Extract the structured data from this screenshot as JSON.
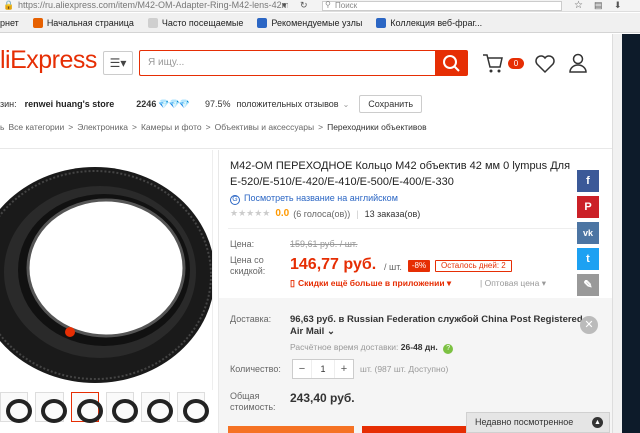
{
  "browser": {
    "url": "https://ru.aliexpress.com/item/M42-OM-Adapter-Ring-M42-lens-42mm",
    "search_placeholder": "Поиск",
    "bookmarks": [
      {
        "label": "рнет",
        "color": "#3a78c2"
      },
      {
        "label": "Начальная страница",
        "color": "#e66000"
      },
      {
        "label": "Часто посещаемые",
        "color": "#888888"
      },
      {
        "label": "Рекомендуемые узлы",
        "color": "#2b66c4"
      },
      {
        "label": "Коллекция веб-фраг...",
        "color": "#2b66c4"
      }
    ]
  },
  "header": {
    "logo": "liExpress",
    "search_placeholder": "Я ищу...",
    "cart_count": "0"
  },
  "store": {
    "label": "зин:",
    "name": "renwei huang's store",
    "rank": "2246",
    "diamonds": "💎💎💎",
    "positive_pct": "97.5%",
    "positive_label": "положительных отзывов",
    "save_label": "Сохранить"
  },
  "breadcrumbs": [
    "Все категории",
    ">",
    "Электроника",
    ">",
    "Камеры и фото",
    ">",
    "Объективы и аксессуары",
    ">",
    "Переходники объективов"
  ],
  "breadcrumb_prefix": "ь",
  "product": {
    "title": "M42-OM ПЕРЕХОДНОЕ Кольцо M42 объектив 42 мм 0 lympus Для E-520/E-510/E-420/E-410/E-500/E-400/E-330",
    "english_link": "Посмотреть название на английском",
    "rating_score": "0.0",
    "votes": "(6 голоса(ов))",
    "orders": "13 заказа(ов)",
    "price_label": "Цена:",
    "old_price": "159,61 руб. / шт.",
    "discount_label": "Цена со скидкой:",
    "new_price": "146,77 руб.",
    "per_unit": "/ шт.",
    "discount_badge": "-8%",
    "days_left": "Осталось дней: 2",
    "app_discount": "Скидки ещё больше в приложении",
    "wholesale": "Оптовая цена"
  },
  "shipping": {
    "label": "Доставка:",
    "text": "96,63 руб. в Russian Federation службой China Post Registered Air Mail",
    "time_label": "Расчётное время доставки:",
    "time_value": "26-48 дн."
  },
  "quantity": {
    "label": "Количество:",
    "value": "1",
    "note": "шт. (987 шт. Доступно)"
  },
  "total": {
    "label": "Общая стоимость:",
    "value": "243,40 руб."
  },
  "recently_viewed": "Недавно посмотренное",
  "colors": {
    "brand": "#e62e04",
    "facebook": "#3b5998",
    "pinterest": "#cb2027",
    "vk": "#4c75a3",
    "twitter": "#1da1f2",
    "edit": "#999999"
  }
}
